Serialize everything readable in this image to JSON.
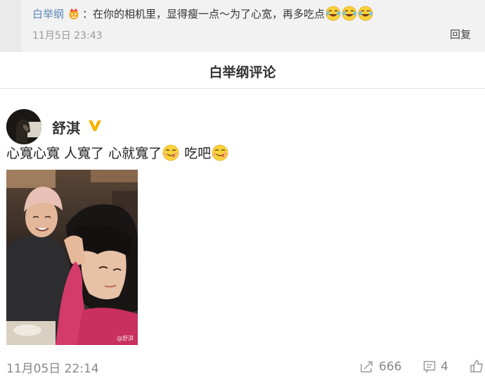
{
  "reply": {
    "author": "白举纲",
    "text": "：在你的相机里，显得瘦一点～为了心宽，再多吃点",
    "time": "11月5日 23:43",
    "reply_label": "回复"
  },
  "section": {
    "title": "白举纲评论"
  },
  "post": {
    "username": "舒淇",
    "text_part1": "心寬心寬 人寬了 心就寬了",
    "text_part2": " 吃吧",
    "photo_watermark": "@舒淇",
    "time": "11月05日 22:14",
    "reposts": "666",
    "comments": "4"
  },
  "colors": {
    "author_link": "#5a86b5",
    "verified": "#f5b301",
    "background_strip": "#f2f2f2"
  },
  "icons": [
    "crown-badge-icon",
    "laugh-cry-emoji-icon",
    "verified-icon",
    "yum-emoji-icon",
    "repost-icon",
    "comment-icon",
    "like-icon"
  ]
}
